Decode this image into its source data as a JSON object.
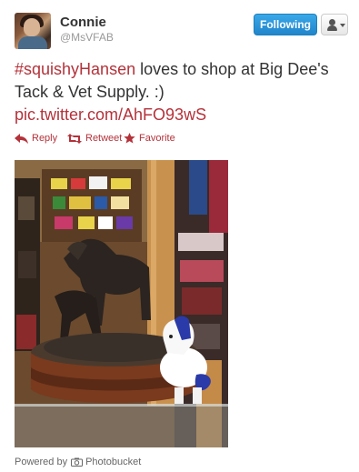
{
  "user": {
    "display_name": "Connie",
    "screen_name": "@MsVFAB",
    "avatar_icon": "profile-photo"
  },
  "header": {
    "follow_label": "Following",
    "follow_color": "#2b90d9",
    "user_menu_icon": "user-dropdown-icon"
  },
  "tweet": {
    "hashtag": "#squishyHansen",
    "text_after_hashtag": " loves to shop at Big Dee's Tack & Vet Supply. :)",
    "media_link": "pic.twitter.com/AhFO93wS",
    "link_color": "#b4323a"
  },
  "actions": [
    {
      "label": "Reply",
      "icon": "reply-icon"
    },
    {
      "label": "Retweet",
      "icon": "retweet-icon"
    },
    {
      "label": "Favorite",
      "icon": "star-icon"
    }
  ],
  "media": {
    "icon": "photo-of-horse-statue-and-unicorn-toy-in-tack-shop"
  },
  "footer": {
    "powered_prefix": "Powered by",
    "provider": "Photobucket",
    "icon": "camera-icon"
  }
}
